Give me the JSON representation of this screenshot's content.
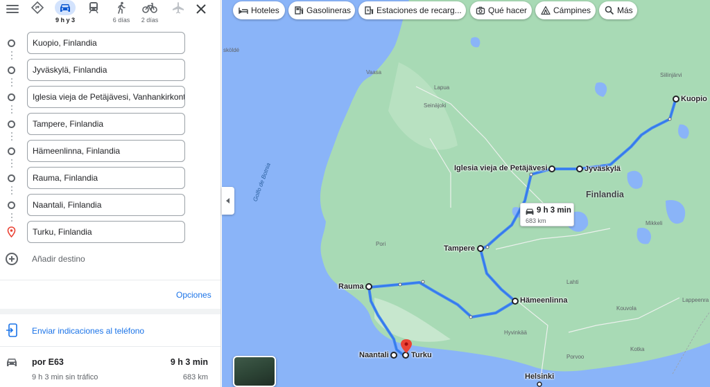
{
  "travel_modes": [
    {
      "name": "best",
      "label": ""
    },
    {
      "name": "driving",
      "label": "9 h y 3"
    },
    {
      "name": "transit",
      "label": ""
    },
    {
      "name": "walking",
      "label": "6 días"
    },
    {
      "name": "cycling",
      "label": "2 días"
    },
    {
      "name": "flight",
      "label": ""
    }
  ],
  "stops": [
    "Kuopio, Finlandia",
    "Jyväskylä, Finlandia",
    "Iglesia vieja de Petäjävesi, Vanhankirkontie",
    "Tampere, Finlandia",
    "Hämeenlinna, Finlandia",
    "Rauma, Finlandia",
    "Naantali, Finlandia",
    "Turku, Finlandia"
  ],
  "add_destination": "Añadir destino",
  "options_label": "Opciones",
  "send_to_phone": "Enviar indicaciones al teléfono",
  "route": {
    "via": "por E63",
    "time": "9 h 3 min",
    "without_traffic": "9 h 3 min sin tráfico",
    "distance": "683 km"
  },
  "chips": [
    "Hoteles",
    "Gasolineras",
    "Estaciones de recarg...",
    "Qué hacer",
    "Cámpines",
    "Más"
  ],
  "map": {
    "info_time": "9 h 3 min",
    "info_distance": "683 km",
    "country": "Finlandia",
    "gulf": "Golfo de Botnia",
    "route_cities": {
      "kuopio": "Kuopio",
      "jyvaskyla": "Jyväskylä",
      "petajavesi": "Iglesia vieja de Petäjävesi",
      "tampere": "Tampere",
      "hameenlinna": "Hämeenlinna",
      "rauma": "Rauma",
      "naantali": "Naantali",
      "turku": "Turku",
      "helsinki": "Helsinki"
    },
    "small_places": {
      "skolde": "sköldé",
      "vaasa": "Vaasa",
      "lapua": "Lapua",
      "seinajoki": "Seinäjoki",
      "siilinjarvi": "Siilinjärvi",
      "pori": "Pori",
      "mikkeli": "Mikkeli",
      "lahti": "Lahti",
      "kouvola": "Kouvola",
      "lappeenranta": "Lappeenra",
      "hyvinkaa": "Hyvinkää",
      "porvoo": "Porvoo",
      "kotka": "Kotka"
    }
  },
  "colors": {
    "route": "#4285f4",
    "water": "#8ab4f8",
    "land": "#a8dab5",
    "accent": "#1a73e8",
    "active_mode_bg": "#d3e3fd",
    "pin": "#ea4335"
  }
}
